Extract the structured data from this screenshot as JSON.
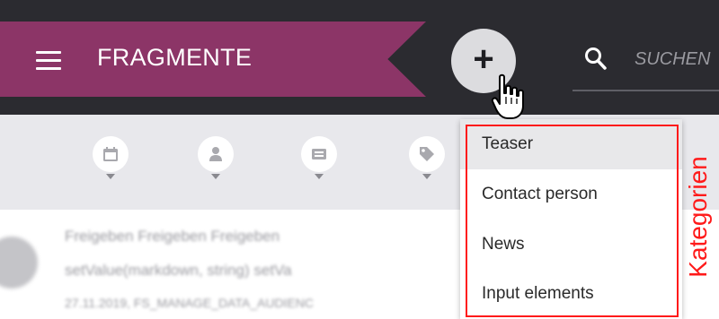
{
  "header": {
    "title": "FRAGMENTE",
    "menu_icon": "hamburger-menu-icon",
    "add_icon": "plus-icon",
    "search": {
      "placeholder": "SUCHEN",
      "icon": "search-icon"
    }
  },
  "filters": [
    {
      "icon": "calendar-icon"
    },
    {
      "icon": "person-icon"
    },
    {
      "icon": "card-icon"
    },
    {
      "icon": "tag-icon"
    }
  ],
  "list_preview": {
    "lines": [
      "Freigeben Freigeben Freigeben",
      "setValue(markdown, string) setVa",
      "27.11.2019, FS_MANAGE_DATA_AUDIENC"
    ]
  },
  "dropdown": {
    "items": [
      {
        "label": "Teaser",
        "hovered": true
      },
      {
        "label": "Contact person",
        "hovered": false
      },
      {
        "label": "News",
        "hovered": false
      },
      {
        "label": "Input elements",
        "hovered": false
      }
    ]
  },
  "annotation": {
    "label": "Kategorien",
    "color": "#ff1a1a"
  },
  "colors": {
    "header_bg": "#2b2b30",
    "ribbon": "#8c3567",
    "filter_bar": "#e8e8ec",
    "add_button": "#dcdcdf"
  }
}
